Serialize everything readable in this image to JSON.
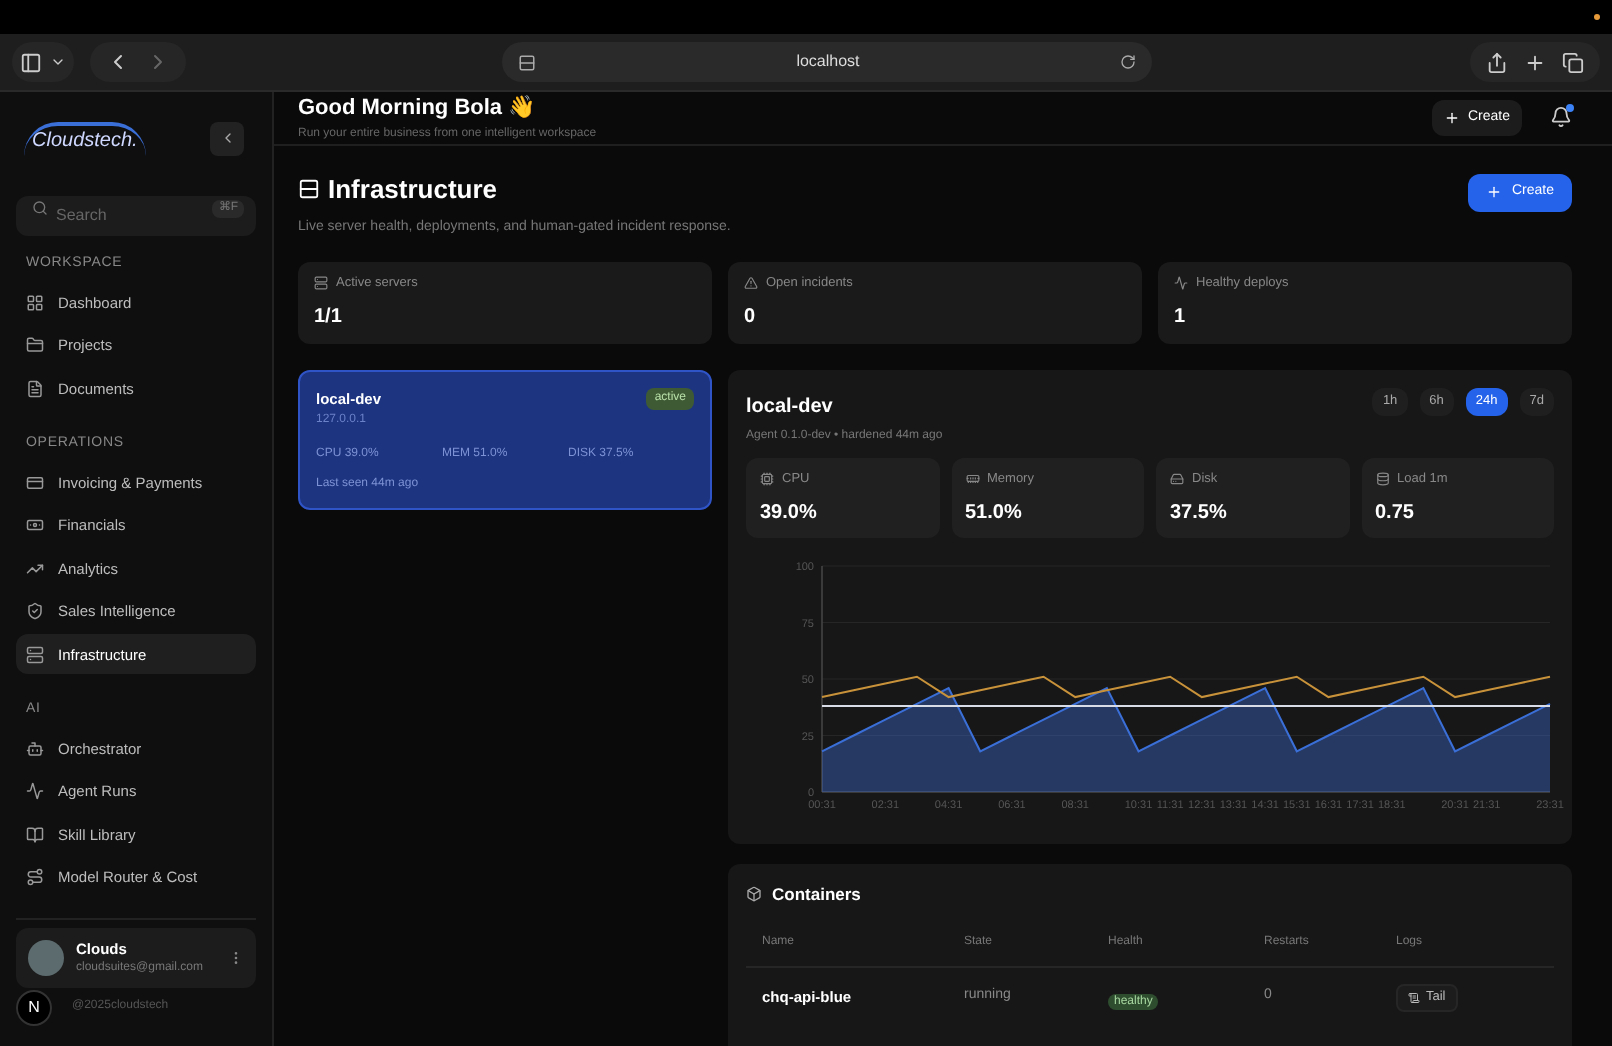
{
  "browser": {
    "address": "localhost"
  },
  "sidebar": {
    "logo": "Cloudstech.",
    "search": {
      "placeholder": "Search",
      "shortcut": "⌘F"
    },
    "sections": [
      {
        "title": "WORKSPACE",
        "items": [
          {
            "label": "Dashboard",
            "selected": false
          },
          {
            "label": "Projects",
            "selected": false
          },
          {
            "label": "Documents",
            "selected": false
          }
        ]
      },
      {
        "title": "OPERATIONS",
        "items": [
          {
            "label": "Invoicing & Payments",
            "selected": false
          },
          {
            "label": "Financials",
            "selected": false
          },
          {
            "label": "Analytics",
            "selected": false
          },
          {
            "label": "Sales Intelligence",
            "selected": false
          },
          {
            "label": "Infrastructure",
            "selected": true
          }
        ]
      },
      {
        "title": "AI",
        "items": [
          {
            "label": "Orchestrator",
            "selected": false
          },
          {
            "label": "Agent Runs",
            "selected": false
          },
          {
            "label": "Skill Library",
            "selected": false
          },
          {
            "label": "Model Router & Cost",
            "selected": false
          }
        ]
      }
    ],
    "user": {
      "name": "Clouds",
      "email": "cloudsuites@gmail.com",
      "badge": "N",
      "footer": "@2025cloudstech"
    }
  },
  "header": {
    "greeting": "Good Morning Bola 👋",
    "subtitle": "Run your entire business from one intelligent workspace",
    "create": "Create",
    "notification_dot": true
  },
  "page": {
    "title": "Infrastructure",
    "subtitle": "Live server health, deployments, and human-gated incident response.",
    "create": "Create"
  },
  "stats": [
    {
      "label": "Active servers",
      "value": "1/1"
    },
    {
      "label": "Open incidents",
      "value": "0"
    },
    {
      "label": "Healthy deploys",
      "value": "1"
    }
  ],
  "servers": [
    {
      "name": "local-dev",
      "address": "127.0.0.1",
      "status": "active",
      "selected": true,
      "cpu": "CPU 39.0%",
      "mem": "MEM 51.0%",
      "disk": "DISK 37.5%",
      "last_seen": "Last seen 44m ago"
    }
  ],
  "detail": {
    "name": "local-dev",
    "subtitle": "Agent 0.1.0-dev • hardened 44m ago",
    "ranges": [
      {
        "label": "1h",
        "selected": false
      },
      {
        "label": "6h",
        "selected": false
      },
      {
        "label": "24h",
        "selected": true
      },
      {
        "label": "7d",
        "selected": false
      }
    ],
    "metrics": [
      {
        "label": "CPU",
        "value": "39.0%"
      },
      {
        "label": "Memory",
        "value": "51.0%"
      },
      {
        "label": "Disk",
        "value": "37.5%"
      },
      {
        "label": "Load 1m",
        "value": "0.75"
      }
    ],
    "chart_data": {
      "type": "area",
      "categories": [
        "00:31",
        null,
        "02:31",
        null,
        "04:31",
        null,
        "06:31",
        null,
        "08:31",
        null,
        "10:31",
        "11:31",
        "12:31",
        "13:31",
        "14:31",
        "15:31",
        "16:31",
        "17:31",
        "18:31",
        null,
        "20:31",
        "21:31",
        null,
        "23:31"
      ],
      "series": [
        {
          "type": "area",
          "color": "#3b6fd8",
          "values": [
            18,
            25,
            32,
            39,
            46,
            18,
            25,
            32,
            39,
            46,
            18,
            25,
            32,
            39,
            46,
            18,
            25,
            32,
            39,
            46,
            18,
            25,
            32,
            39
          ]
        },
        {
          "type": "line",
          "color": "#c8923a",
          "values": [
            42,
            45,
            48,
            51,
            42,
            45,
            48,
            51,
            42,
            45,
            48,
            51,
            42,
            45,
            48,
            51,
            42,
            45,
            48,
            51,
            42,
            45,
            48,
            51
          ]
        },
        {
          "type": "line",
          "color": "#d8dce6",
          "values": [
            38,
            38,
            38,
            38,
            38,
            38,
            38,
            38,
            38,
            38,
            38,
            38,
            38,
            38,
            38,
            38,
            38,
            38,
            38,
            38,
            38,
            38,
            38,
            38
          ]
        }
      ],
      "grid": true,
      "ylim": [
        0,
        100
      ],
      "yticks": [
        0,
        25,
        50,
        75,
        100
      ]
    }
  },
  "containers": {
    "title": "Containers",
    "columns": [
      "Name",
      "State",
      "Health",
      "Restarts",
      "Logs"
    ],
    "rows": [
      {
        "name": "chq-api-blue",
        "state": "running",
        "health": "healthy",
        "restarts": "0",
        "logs": "Tail"
      }
    ]
  }
}
